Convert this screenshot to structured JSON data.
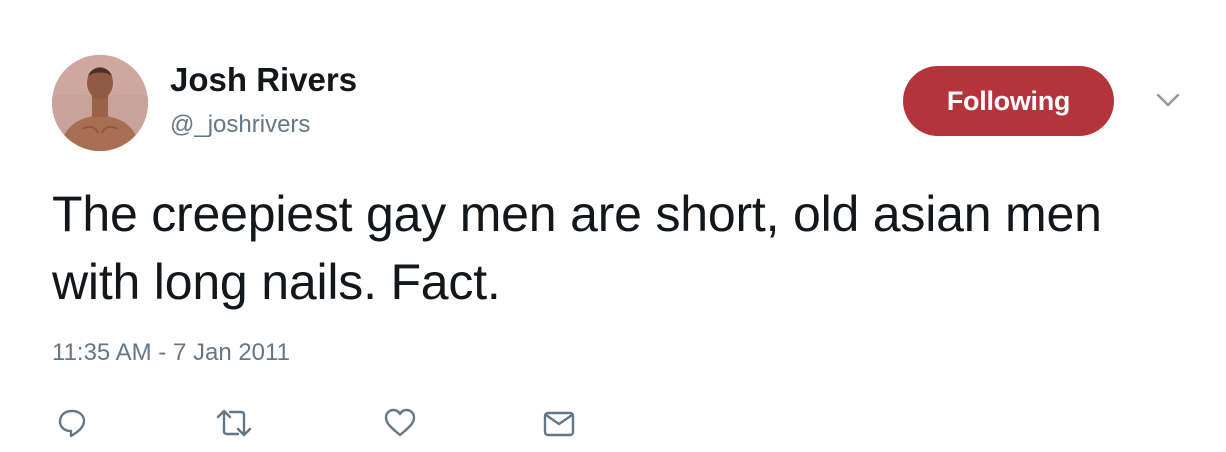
{
  "author": {
    "display_name": "Josh Rivers",
    "handle": "@_joshrivers",
    "avatar_icon": "profile-photo"
  },
  "follow_button": {
    "label": "Following",
    "color": "#b5333a"
  },
  "menu": {
    "icon": "chevron-down-icon"
  },
  "tweet": {
    "text": "The creepiest gay men are short, old asian men with long nails. Fact.",
    "timestamp": "11:35 AM - 7 Jan 2011"
  },
  "actions": [
    {
      "icon": "reply-icon"
    },
    {
      "icon": "retweet-icon"
    },
    {
      "icon": "like-icon"
    },
    {
      "icon": "message-icon"
    }
  ],
  "colors": {
    "text": "#14171a",
    "secondary": "#657786"
  }
}
